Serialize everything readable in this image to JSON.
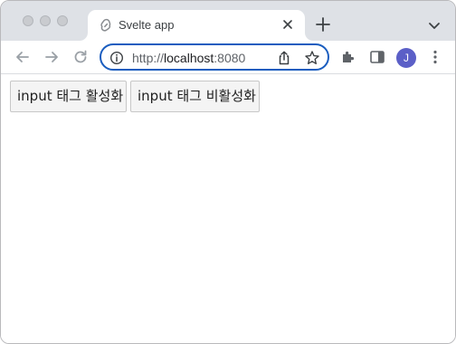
{
  "tab": {
    "title": "Svelte app"
  },
  "address_bar": {
    "scheme": "http://",
    "host": "localhost",
    "port": ":8080"
  },
  "profile": {
    "initial": "J"
  },
  "page": {
    "buttons": [
      {
        "label": "input 태그 활성화"
      },
      {
        "label": "input 태그 비활성화"
      }
    ]
  },
  "icons": {
    "tab_favicon": "svelte-icon",
    "tab_close": "close-icon",
    "new_tab": "plus-icon",
    "tab_search": "chevron-down-icon",
    "back": "arrow-left-icon",
    "forward": "arrow-right-icon",
    "reload": "reload-icon",
    "site_info": "info-icon",
    "share": "share-icon",
    "bookmark": "star-icon",
    "extensions": "puzzle-icon",
    "side_panel": "side-panel-icon",
    "menu": "kebab-menu-icon"
  },
  "colors": {
    "accent": "#1a5dbf",
    "avatar": "#5b5fc7",
    "tabstrip": "#dee1e6"
  }
}
